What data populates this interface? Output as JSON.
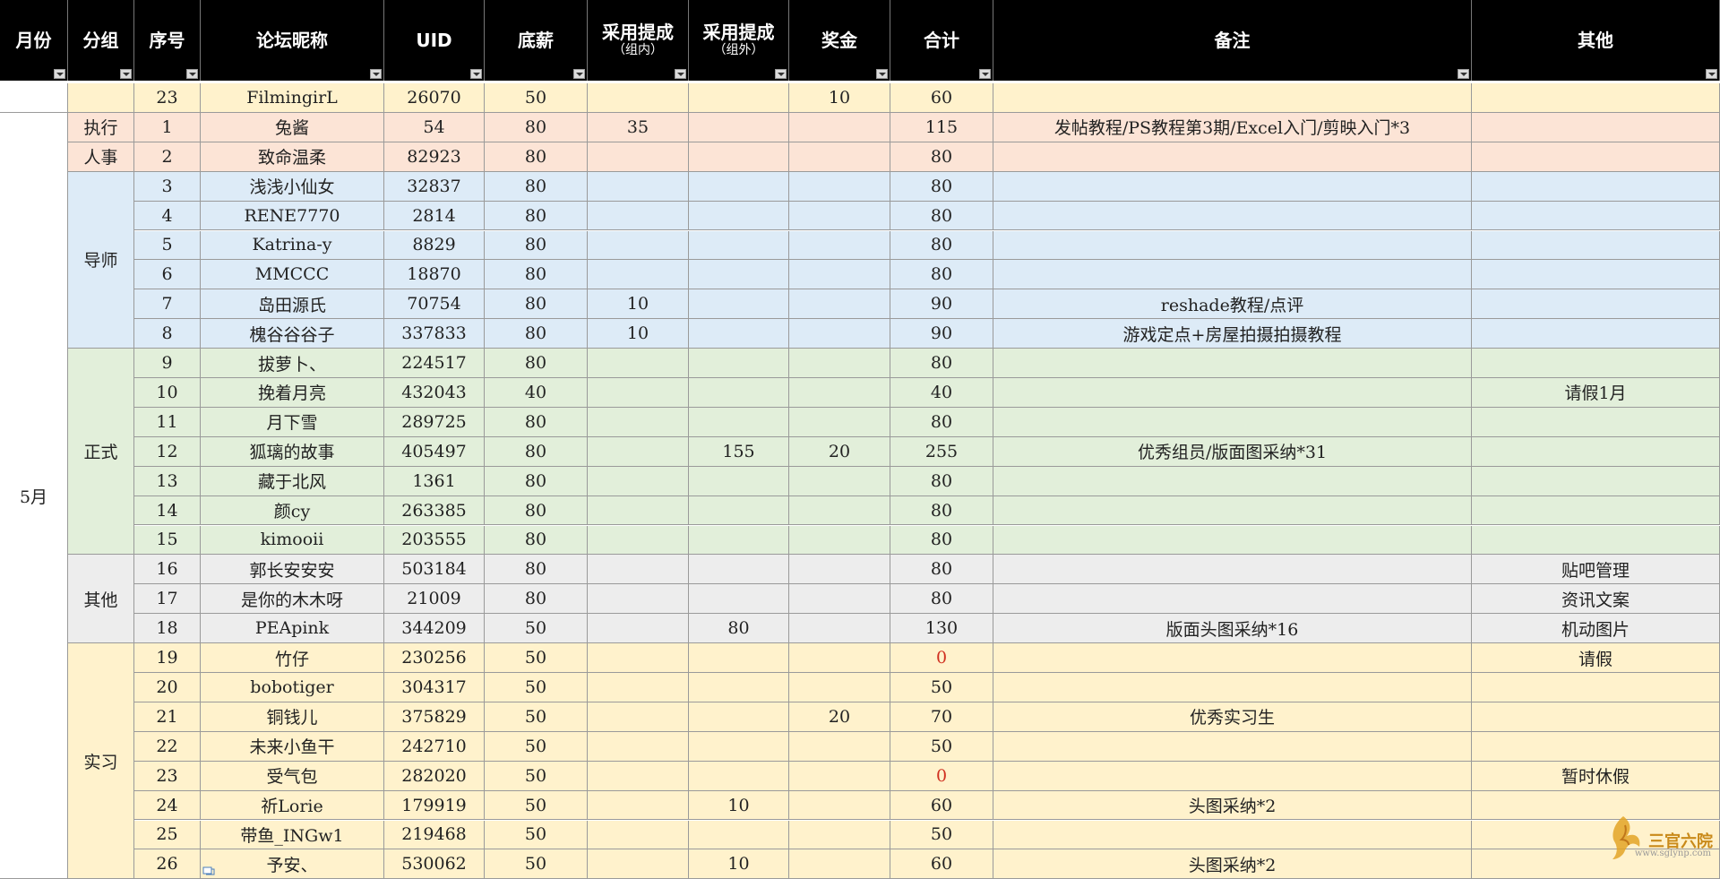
{
  "headers": [
    {
      "key": "month",
      "label": "月份",
      "sub": ""
    },
    {
      "key": "group",
      "label": "分组",
      "sub": ""
    },
    {
      "key": "no",
      "label": "序号",
      "sub": ""
    },
    {
      "key": "nick",
      "label": "论坛昵称",
      "sub": ""
    },
    {
      "key": "uid",
      "label": "UID",
      "sub": ""
    },
    {
      "key": "base",
      "label": "底薪",
      "sub": ""
    },
    {
      "key": "adopt_in",
      "label": "采用提成",
      "sub": "（组内）"
    },
    {
      "key": "adopt_out",
      "label": "采用提成",
      "sub": "（组外）"
    },
    {
      "key": "bonus",
      "label": "奖金",
      "sub": ""
    },
    {
      "key": "total",
      "label": "合计",
      "sub": ""
    },
    {
      "key": "note",
      "label": "备注",
      "sub": ""
    },
    {
      "key": "other",
      "label": "其他",
      "sub": ""
    }
  ],
  "month_label": "5月",
  "colors": {
    "header_bg": "#000000",
    "yellow": "#fff2cc",
    "pink": "#fce4d6",
    "blue": "#ddebf7",
    "green": "#e2efda",
    "gray": "#ededed",
    "zero_red": "#d03020"
  },
  "groups": [
    {
      "label": "",
      "color": "yellow",
      "rows": 1
    },
    {
      "label": "执行",
      "color": "pink",
      "rows": 1
    },
    {
      "label": "人事",
      "color": "pink",
      "rows": 1
    },
    {
      "label": "导师",
      "color": "blue",
      "rows": 6
    },
    {
      "label": "正式",
      "color": "green",
      "rows": 7
    },
    {
      "label": "其他",
      "color": "gray",
      "rows": 3
    },
    {
      "label": "实习",
      "color": "yellow",
      "rows": 8
    }
  ],
  "rows": [
    {
      "no": "23",
      "nick": "FilmingirL",
      "uid": "26070",
      "base": "50",
      "adopt_in": "",
      "adopt_out": "",
      "bonus": "10",
      "total": "60",
      "note": "",
      "other": ""
    },
    {
      "no": "1",
      "nick": "兔酱",
      "uid": "54",
      "base": "80",
      "adopt_in": "35",
      "adopt_out": "",
      "bonus": "",
      "total": "115",
      "note": "发帖教程/PS教程第3期/Excel入门/剪映入门*3",
      "other": ""
    },
    {
      "no": "2",
      "nick": "致命温柔",
      "uid": "82923",
      "base": "80",
      "adopt_in": "",
      "adopt_out": "",
      "bonus": "",
      "total": "80",
      "note": "",
      "other": ""
    },
    {
      "no": "3",
      "nick": "浅浅小仙女",
      "uid": "32837",
      "base": "80",
      "adopt_in": "",
      "adopt_out": "",
      "bonus": "",
      "total": "80",
      "note": "",
      "other": ""
    },
    {
      "no": "4",
      "nick": "RENE7770",
      "uid": "2814",
      "base": "80",
      "adopt_in": "",
      "adopt_out": "",
      "bonus": "",
      "total": "80",
      "note": "",
      "other": ""
    },
    {
      "no": "5",
      "nick": "Katrina-y",
      "uid": "8829",
      "base": "80",
      "adopt_in": "",
      "adopt_out": "",
      "bonus": "",
      "total": "80",
      "note": "",
      "other": ""
    },
    {
      "no": "6",
      "nick": "MMCCC",
      "uid": "18870",
      "base": "80",
      "adopt_in": "",
      "adopt_out": "",
      "bonus": "",
      "total": "80",
      "note": "",
      "other": ""
    },
    {
      "no": "7",
      "nick": "岛田源氏",
      "uid": "70754",
      "base": "80",
      "adopt_in": "10",
      "adopt_out": "",
      "bonus": "",
      "total": "90",
      "note": "reshade教程/点评",
      "other": ""
    },
    {
      "no": "8",
      "nick": "槐谷谷谷子",
      "uid": "337833",
      "base": "80",
      "adopt_in": "10",
      "adopt_out": "",
      "bonus": "",
      "total": "90",
      "note": "游戏定点+房屋拍摄拍摄教程",
      "other": ""
    },
    {
      "no": "9",
      "nick": "拔萝卜、",
      "uid": "224517",
      "base": "80",
      "adopt_in": "",
      "adopt_out": "",
      "bonus": "",
      "total": "80",
      "note": "",
      "other": ""
    },
    {
      "no": "10",
      "nick": "挽着月亮",
      "uid": "432043",
      "base": "40",
      "adopt_in": "",
      "adopt_out": "",
      "bonus": "",
      "total": "40",
      "note": "",
      "other": "请假1月"
    },
    {
      "no": "11",
      "nick": "月下雪",
      "uid": "289725",
      "base": "80",
      "adopt_in": "",
      "adopt_out": "",
      "bonus": "",
      "total": "80",
      "note": "",
      "other": ""
    },
    {
      "no": "12",
      "nick": "狐璃的故事",
      "uid": "405497",
      "base": "80",
      "adopt_in": "",
      "adopt_out": "155",
      "bonus": "20",
      "total": "255",
      "note": "优秀组员/版面图采纳*31",
      "other": ""
    },
    {
      "no": "13",
      "nick": "藏于北风",
      "uid": "1361",
      "base": "80",
      "adopt_in": "",
      "adopt_out": "",
      "bonus": "",
      "total": "80",
      "note": "",
      "other": ""
    },
    {
      "no": "14",
      "nick": "颜cy",
      "uid": "263385",
      "base": "80",
      "adopt_in": "",
      "adopt_out": "",
      "bonus": "",
      "total": "80",
      "note": "",
      "other": ""
    },
    {
      "no": "15",
      "nick": "kimooii",
      "uid": "203555",
      "base": "80",
      "adopt_in": "",
      "adopt_out": "",
      "bonus": "",
      "total": "80",
      "note": "",
      "other": ""
    },
    {
      "no": "16",
      "nick": "郭长安安安",
      "uid": "503184",
      "base": "80",
      "adopt_in": "",
      "adopt_out": "",
      "bonus": "",
      "total": "80",
      "note": "",
      "other": "贴吧管理"
    },
    {
      "no": "17",
      "nick": "是你的木木呀",
      "uid": "21009",
      "base": "80",
      "adopt_in": "",
      "adopt_out": "",
      "bonus": "",
      "total": "80",
      "note": "",
      "other": "资讯文案"
    },
    {
      "no": "18",
      "nick": "PEApink",
      "uid": "344209",
      "base": "50",
      "adopt_in": "",
      "adopt_out": "80",
      "bonus": "",
      "total": "130",
      "note": "版面头图采纳*16",
      "other": "机动图片"
    },
    {
      "no": "19",
      "nick": "竹仔",
      "uid": "230256",
      "base": "50",
      "adopt_in": "",
      "adopt_out": "",
      "bonus": "",
      "total": "0",
      "note": "",
      "other": "请假"
    },
    {
      "no": "20",
      "nick": "bobotiger",
      "uid": "304317",
      "base": "50",
      "adopt_in": "",
      "adopt_out": "",
      "bonus": "",
      "total": "50",
      "note": "",
      "other": ""
    },
    {
      "no": "21",
      "nick": "铜钱儿",
      "uid": "375829",
      "base": "50",
      "adopt_in": "",
      "adopt_out": "",
      "bonus": "20",
      "total": "70",
      "note": "优秀实习生",
      "other": ""
    },
    {
      "no": "22",
      "nick": "未来小鱼干",
      "uid": "242710",
      "base": "50",
      "adopt_in": "",
      "adopt_out": "",
      "bonus": "",
      "total": "50",
      "note": "",
      "other": ""
    },
    {
      "no": "23",
      "nick": "受气包",
      "uid": "282020",
      "base": "50",
      "adopt_in": "",
      "adopt_out": "",
      "bonus": "",
      "total": "0",
      "note": "",
      "other": "暂时休假"
    },
    {
      "no": "24",
      "nick": "祈Lorie",
      "uid": "179919",
      "base": "50",
      "adopt_in": "",
      "adopt_out": "10",
      "bonus": "",
      "total": "60",
      "note": "头图采纳*2",
      "other": ""
    },
    {
      "no": "25",
      "nick": "带鱼_INGw1",
      "uid": "219468",
      "base": "50",
      "adopt_in": "",
      "adopt_out": "",
      "bonus": "",
      "total": "50",
      "note": "",
      "other": ""
    },
    {
      "no": "26",
      "nick": "予安、",
      "uid": "530062",
      "base": "50",
      "adopt_in": "",
      "adopt_out": "10",
      "bonus": "",
      "total": "60",
      "note": "头图采纳*2",
      "other": ""
    }
  ],
  "watermark": {
    "brand": "三官六院",
    "url": "www.sglynp.com",
    "icon": "phoenix-logo-icon"
  }
}
